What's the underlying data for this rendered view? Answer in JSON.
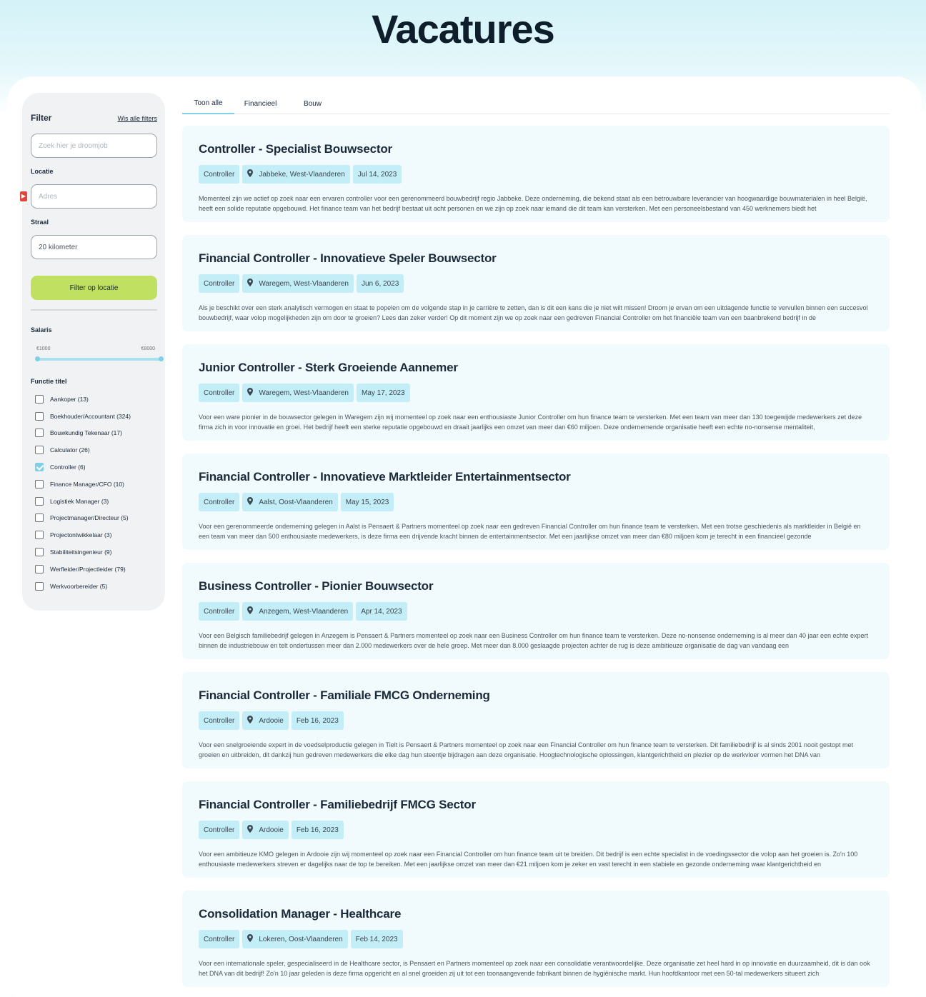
{
  "page": {
    "title": "Vacatures"
  },
  "sidebar": {
    "filter_title": "Filter",
    "clear_filters": "Wis alle filters",
    "search_placeholder": "Zoek hier je droomjob",
    "location_label": "Locatie",
    "location_placeholder": "Adres",
    "radius_label": "Straal",
    "radius_value": "20 kilometer",
    "filter_button": "Filter op locatie",
    "salary_label": "Salaris",
    "salary_min": "€1000",
    "salary_max": "€8000",
    "function_label": "Functie titel",
    "functions": [
      {
        "label": "Aankoper (13)",
        "checked": false
      },
      {
        "label": "Boekhouder/Accountant (324)",
        "checked": false
      },
      {
        "label": "Bouwkundig Tekenaar (17)",
        "checked": false
      },
      {
        "label": "Calculator (26)",
        "checked": false
      },
      {
        "label": "Controller (6)",
        "checked": true
      },
      {
        "label": "Finance Manager/CFO (10)",
        "checked": false
      },
      {
        "label": "Logistiek Manager (3)",
        "checked": false
      },
      {
        "label": "Projectmanager/Directeur (5)",
        "checked": false
      },
      {
        "label": "Projectontwikkelaar (3)",
        "checked": false
      },
      {
        "label": "Stabiliteitsingenieur (9)",
        "checked": false
      },
      {
        "label": "Werfleider/Projectleider (79)",
        "checked": false
      },
      {
        "label": "Werkvoorbereider (5)",
        "checked": false
      }
    ]
  },
  "tabs": [
    {
      "label": "Toon alle",
      "active": true
    },
    {
      "label": "Financieel",
      "active": false
    },
    {
      "label": "Bouw",
      "active": false
    }
  ],
  "jobs": [
    {
      "title": "Controller - Specialist Bouwsector",
      "category": "Controller",
      "location": "Jabbeke, West-Vlaanderen",
      "date": "Jul 14, 2023",
      "description": "Momenteel zijn we actief op zoek naar een ervaren controller voor een gerenommeerd bouwbedrijf regio Jabbeke. Deze onderneming, die bekend staat als een betrouwbare leverancier van hoogwaardige bouwmaterialen in heel België, heeft een solide reputatie opgebouwd. Het finance team van het bedrijf bestaat uit acht personen en we zijn op zoek naar iemand die dit team kan versterken. Met een personeelsbestand van 450 werknemers biedt het"
    },
    {
      "title": "Financial Controller - Innovatieve Speler Bouwsector",
      "category": "Controller",
      "location": "Waregem, West-Vlaanderen",
      "date": "Jun 6, 2023",
      "description": "Als je beschikt over een sterk analytisch vermogen en staat te popelen om de volgende stap in je carrière te zetten, dan is dit een kans die je niet wilt missen! Droom je ervan om een uitdagende functie te vervullen binnen een succesvol bouwbedrijf, waar volop mogelijkheden zijn om door te groeien? Lees dan zeker verder! Op dit moment zijn we op zoek naar een gedreven Financial Controller om het financiële team van een baanbrekend bedrijf in de"
    },
    {
      "title": "Junior Controller - Sterk Groeiende Aannemer",
      "category": "Controller",
      "location": "Waregem, West-Vlaanderen",
      "date": "May 17, 2023",
      "description": "Voor een ware pionier in de bouwsector gelegen in Waregem zijn wij momenteel op zoek naar een enthousiaste Junior Controller om hun finance team te versterken. Met een team van meer dan 130 toegewijde medewerkers zet deze firma zich in voor innovatie en groei. Het bedrijf heeft een sterke reputatie opgebouwd en draait jaarlijks een omzet van meer dan €60 miljoen. Deze ondernemende organisatie heeft een echte no-nonsense mentaliteit,"
    },
    {
      "title": "Financial Controller - Innovatieve Marktleider Entertainmentsector",
      "category": "Controller",
      "location": "Aalst, Oost-Vlaanderen",
      "date": "May 15, 2023",
      "description": "Voor een gerenommeerde onderneming gelegen in Aalst is Pensaert & Partners momenteel op zoek naar een gedreven Financial Controller om hun finance team te versterken. Met een trotse geschiedenis als marktleider in België en een team van meer dan 500 enthousiaste medewerkers, is deze firma een drijvende kracht binnen de entertainmentsector. Met een jaarlijkse omzet van meer dan €80 miljoen kom je terecht in een financieel gezonde"
    },
    {
      "title": "Business Controller - Pionier Bouwsector",
      "category": "Controller",
      "location": "Anzegem, West-Vlaanderen",
      "date": "Apr 14, 2023",
      "description": "Voor een Belgisch familiebedrijf gelegen in Anzegem is Pensaert & Partners momenteel op zoek naar een Business Controller om hun finance team te versterken. Deze no-nonsense onderneming is al meer dan 40 jaar een echte expert binnen de industriebouw en telt ondertussen meer dan 2.000 medewerkers over de hele groep. Met meer dan 8.000 geslaagde projecten achter de rug is deze ambitieuze organisatie de dag van vandaag een"
    },
    {
      "title": "Financial Controller - Familiale FMCG Onderneming",
      "category": "Controller",
      "location": "Ardooie",
      "date": "Feb 16, 2023",
      "description": "Voor een snelgroeiende expert in de voedselproductie gelegen in Tielt is Pensaert & Partners momenteel op zoek naar een Financial Controller om hun finance team te versterken. Dit familiebedrijf is al sinds 2001 nooit gestopt met groeien en uitbreiden, dit dankzij hun gedreven medewerkers die elke dag hun steentje bijdragen aan deze organisatie. Hoogtechnologische oplossingen, klantgerichtheid en plezier op de werkvloer vormen het DNA van"
    },
    {
      "title": "Financial Controller - Familiebedrijf FMCG Sector",
      "category": "Controller",
      "location": "Ardooie",
      "date": "Feb 16, 2023",
      "description": "Voor een ambitieuze KMO gelegen in Ardooie zijn wij momenteel op zoek naar een Financial Controller om hun finance team uit te breiden. Dit bedrijf is een echte specialist in de voedingssector die volop aan het groeien is. Zo'n 100 enthousiaste medewerkers streven er dagelijks naar de top te bereiken. Met een jaarlijkse omzet van meer dan €21 miljoen kom je zeker en vast terecht in een stabiele en gezonde onderneming waar klantgerichtheid en"
    },
    {
      "title": "Consolidation Manager - Healthcare",
      "category": "Controller",
      "location": "Lokeren, Oost-Vlaanderen",
      "date": "Feb 14, 2023",
      "description": "Voor een internationale speler, gespecialiseerd in de Healthcare sector, is Pensaert en Partners momenteel op zoek naar een consolidatie verantwoordelijke. Deze organisatie zet heel hard in op innovatie en duurzaamheid, dit is dan ook het DNA van dit bedrijf! Zo'n 10 jaar geleden is deze firma opgericht en al snel groeiden zij uit tot een toonaangevende fabrikant binnen de hygiënische markt. Hun hoofdkantoor met een 50-tal medewerkers situeert zich"
    }
  ],
  "icons": {
    "location": "map-pin-icon",
    "checkmark": "checkmark-icon"
  },
  "colors": {
    "accent": "#7fd0e6",
    "tag_bg": "#c3edf7",
    "button": "#bfe060",
    "card_bg": "#f1fafd"
  }
}
